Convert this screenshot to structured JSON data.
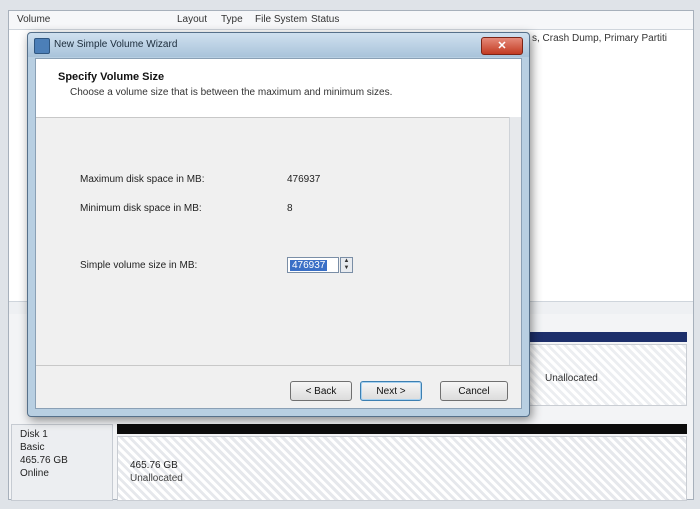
{
  "background": {
    "columns": [
      "Volume",
      "Layout",
      "Type",
      "File System",
      "Status"
    ],
    "row_status": "s, Crash Dump, Primary Partiti",
    "disk0": {
      "partition_label": "Unallocated"
    },
    "disk1": {
      "name": "Disk 1",
      "type": "Basic",
      "size": "465.76 GB",
      "status": "Online",
      "partition_size": "465.76 GB",
      "partition_label": "Unallocated"
    }
  },
  "dialog": {
    "title": "New Simple Volume Wizard",
    "close_glyph": "✕",
    "header_title": "Specify Volume Size",
    "header_subtitle": "Choose a volume size that is between the maximum and minimum sizes.",
    "fields": {
      "max_label": "Maximum disk space in MB:",
      "max_value": "476937",
      "min_label": "Minimum disk space in MB:",
      "min_value": "8",
      "size_label": "Simple volume size in MB:",
      "size_value": "476937"
    },
    "buttons": {
      "back": "< Back",
      "next": "Next >",
      "cancel": "Cancel"
    },
    "spin_up": "▲",
    "spin_down": "▼"
  }
}
